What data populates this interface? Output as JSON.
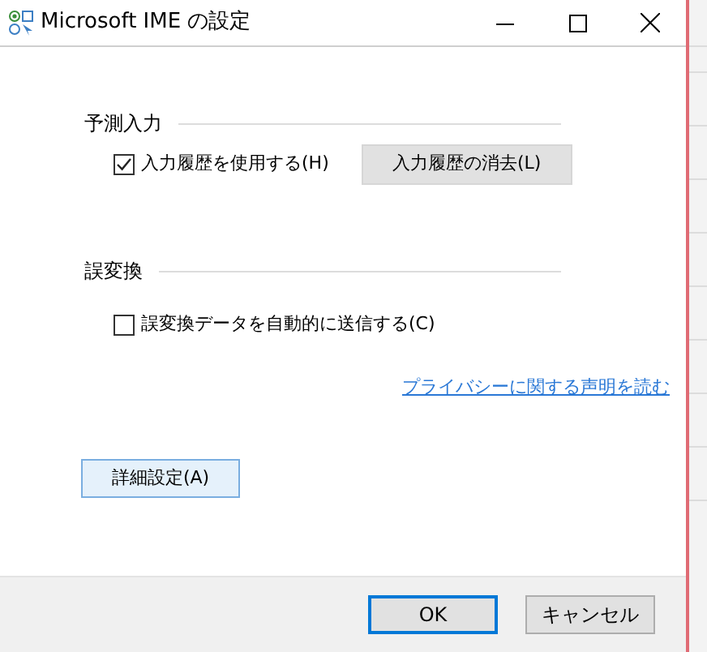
{
  "window": {
    "title": "Microsoft IME の設定"
  },
  "sections": [
    {
      "heading": "予測入力",
      "checkbox": {
        "label": "入力履歴を使用する(H)",
        "checked": true
      },
      "button": "入力履歴の消去(L)"
    },
    {
      "heading": "誤変換",
      "checkbox": {
        "label": "誤変換データを自動的に送信する(C)",
        "checked": false
      }
    }
  ],
  "privacy_link": "プライバシーに関する声明を読む",
  "advanced_button": "詳細設定(A)",
  "footer_buttons": [
    {
      "label": "OK",
      "default": true
    },
    {
      "label": "キャンセル",
      "default": false
    }
  ]
}
